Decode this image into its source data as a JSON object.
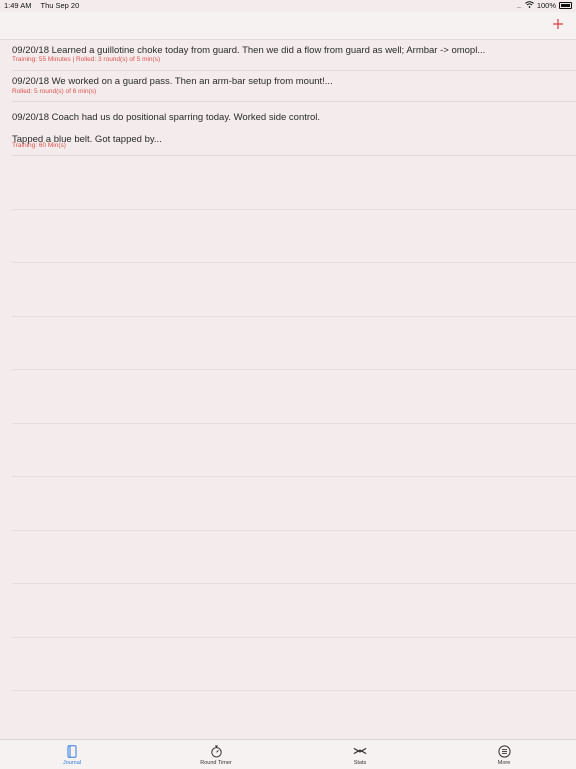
{
  "status_bar": {
    "time": "1:49 AM",
    "date": "Thu Sep 20",
    "signal": "....",
    "battery_percent": "100%"
  },
  "nav": {
    "add_icon": "plus-icon",
    "accent_color": "#e0393e"
  },
  "entries": [
    {
      "text": "09/20/18   Learned a guillotine choke today from guard. Then we did a flow from guard as well; Armbar -> omopl...",
      "meta": "Training: 55 Minutes | Rolled: 3 round(s) of 5 min(s)"
    },
    {
      "text": "09/20/18   We worked on a guard pass. Then an arm-bar setup from mount!...",
      "meta": "Rolled: 5 round(s) of 6 min(s)"
    },
    {
      "text": "09/20/18   Coach had us do positional sparring today. Worked side control.\nTapped a blue belt. Got tapped by...",
      "meta": "Training: 60 Min(s)"
    }
  ],
  "tabs": [
    {
      "label": "Journal",
      "icon": "journal-icon",
      "active": true
    },
    {
      "label": "Round Timer",
      "icon": "stopwatch-icon",
      "active": false
    },
    {
      "label": "Stats",
      "icon": "stats-icon",
      "active": false
    },
    {
      "label": "More",
      "icon": "more-icon",
      "active": false
    }
  ],
  "colors": {
    "background": "#f4ecec",
    "tab_active": "#2f7de1",
    "meta_text": "#d9534f"
  }
}
